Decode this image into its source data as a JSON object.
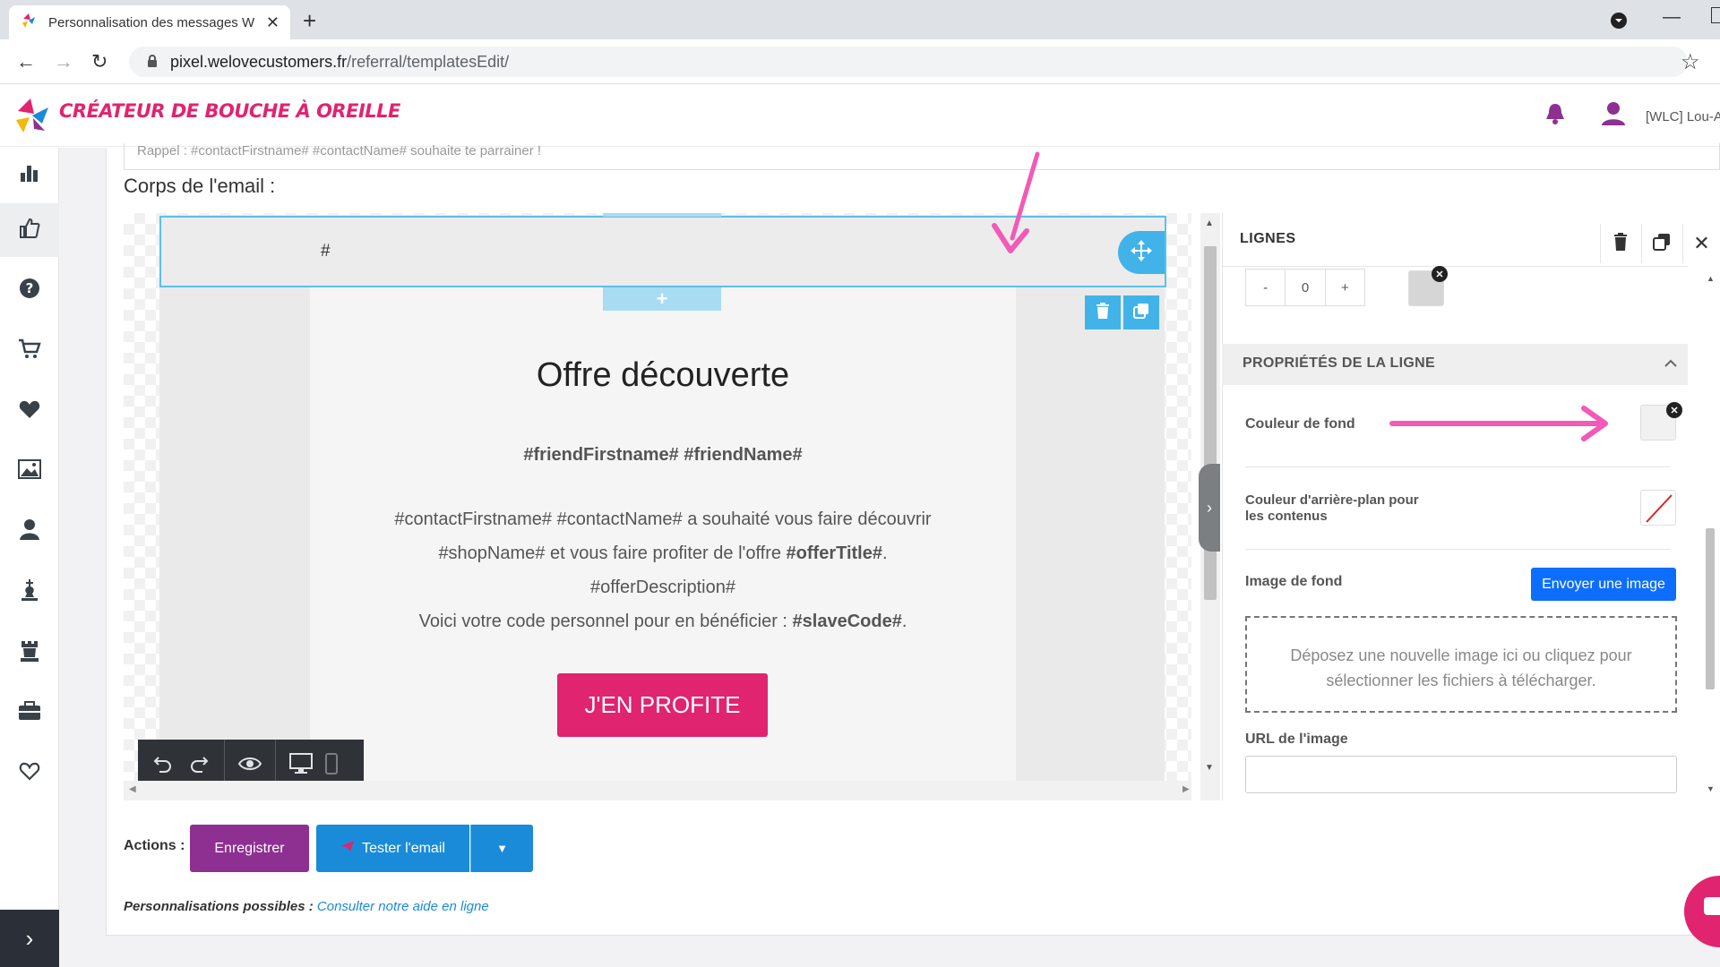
{
  "browser": {
    "tab_title": "Personnalisation des messages W",
    "url_host": "pixel.welovecustomers.fr",
    "url_path": "/referral/templatesEdit/"
  },
  "header": {
    "brand": "CRÉATEUR DE BOUCHE À OREILLE",
    "user": "[WLC] Lou-A"
  },
  "sidebar": {
    "items": [
      "chart-icon",
      "thumbs-up-icon",
      "help-icon",
      "cart-icon",
      "heart-icon",
      "image-icon",
      "user-icon",
      "chess-king-icon",
      "chess-rook-icon",
      "briefcase-icon",
      "heart-outline-icon"
    ]
  },
  "main": {
    "subject_preview": "Rappel : #contactFirstname# #contactName# souhaite te parrainer !",
    "body_label": "Corps de l'email :"
  },
  "editor": {
    "hash_row": "#",
    "title": "Offre découverte",
    "friend_line": "#friendFirstname# #friendName#",
    "line1": "#contactFirstname# #contactName# a souhaité vous faire découvrir",
    "line2_a": "#shopName# et vous faire profiter de l'offre ",
    "line2_b": "#offerTitle#",
    "line2_c": ".",
    "line3": "#offerDescription#",
    "line4_a": "Voici votre code personnel pour en bénéficier : ",
    "line4_b": "#slaveCode#",
    "line4_c": ".",
    "cta": "J'EN PROFITE"
  },
  "panel": {
    "title": "LIGNES",
    "stepper_minus": "-",
    "stepper_value": "0",
    "stepper_plus": "+",
    "section_title": "PROPRIÉTÉS DE LA LIGNE",
    "bg_color_label": "Couleur de fond",
    "content_bg_label_1": "Couleur d'arrière-plan pour",
    "content_bg_label_2": "les contenus",
    "bg_image_label": "Image de fond",
    "upload_button": "Envoyer une image",
    "dropzone_line1": "Déposez une nouvelle image ici ou cliquez pour",
    "dropzone_line2": "sélectionner les fichiers à télécharger.",
    "image_url_label": "URL de l'image",
    "image_url_value": ""
  },
  "actions": {
    "label": "Actions :",
    "save": "Enregistrer",
    "test": "Tester l'email",
    "perso_label": "Personnalisations possibles :",
    "perso_link": "Consulter notre aide en ligne"
  },
  "colors": {
    "brand_pink": "#e0246f",
    "editor_blue": "#42b3e8",
    "save_purple": "#8e3091",
    "test_blue": "#1a8bd8",
    "upload_blue": "#0d6efd",
    "annotation_arrow": "#f15ab6"
  }
}
